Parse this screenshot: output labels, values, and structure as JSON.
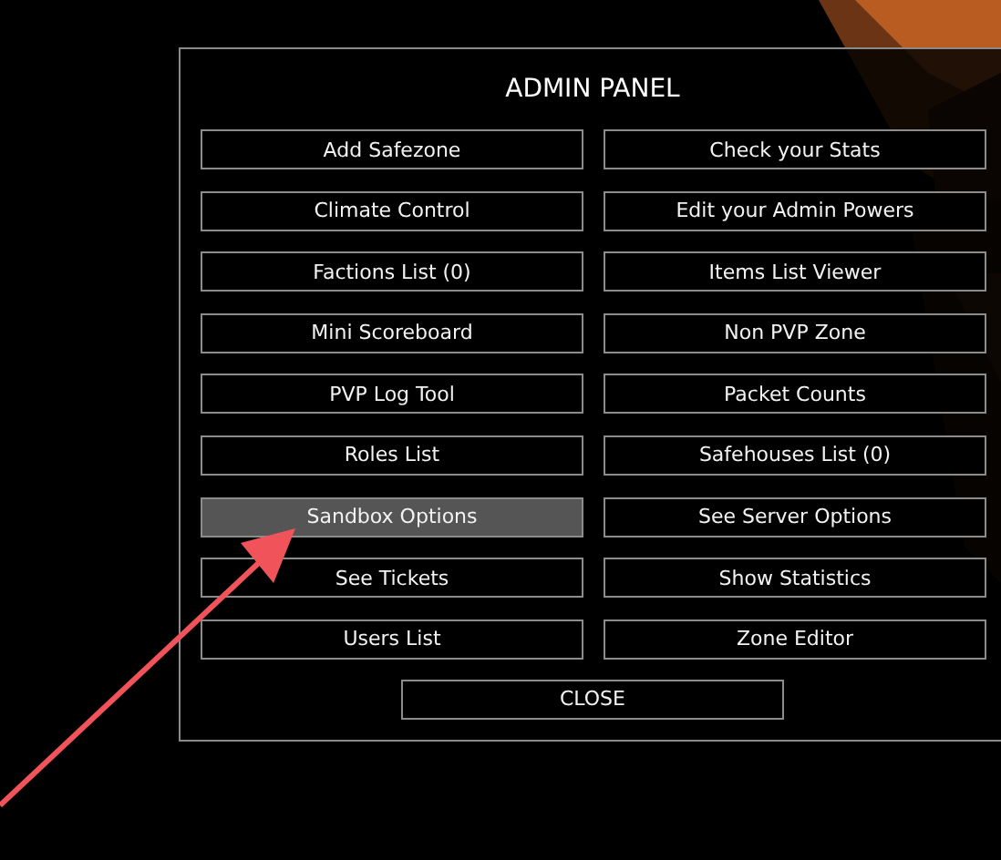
{
  "panel": {
    "title": "ADMIN PANEL",
    "buttons": [
      {
        "label": "Add Safezone",
        "highlighted": false
      },
      {
        "label": "Check your Stats",
        "highlighted": false
      },
      {
        "label": "Climate Control",
        "highlighted": false
      },
      {
        "label": "Edit your Admin Powers",
        "highlighted": false
      },
      {
        "label": "Factions List (0)",
        "highlighted": false
      },
      {
        "label": "Items List Viewer",
        "highlighted": false
      },
      {
        "label": "Mini Scoreboard",
        "highlighted": false
      },
      {
        "label": "Non PVP Zone",
        "highlighted": false
      },
      {
        "label": "PVP Log Tool",
        "highlighted": false
      },
      {
        "label": "Packet Counts",
        "highlighted": false
      },
      {
        "label": "Roles List",
        "highlighted": false
      },
      {
        "label": "Safehouses List (0)",
        "highlighted": false
      },
      {
        "label": "Sandbox Options",
        "highlighted": true
      },
      {
        "label": "See Server Options",
        "highlighted": false
      },
      {
        "label": "See Tickets",
        "highlighted": false
      },
      {
        "label": "Show Statistics",
        "highlighted": false
      },
      {
        "label": "Users List",
        "highlighted": false
      },
      {
        "label": "Zone Editor",
        "highlighted": false
      }
    ],
    "close_button": "CLOSE"
  }
}
